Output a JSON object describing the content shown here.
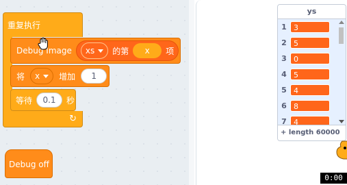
{
  "blocks": {
    "repeat_label": "重复执行",
    "debug_image": {
      "label": "Debug Image",
      "list_name": "xs",
      "of_label": "的第",
      "index_var": "x",
      "item_label": "项"
    },
    "change": {
      "label_prefix": "将",
      "var_name": "x",
      "label_mid": "增加",
      "amount": "1"
    },
    "wait": {
      "label": "等待",
      "seconds": "0.1",
      "unit": "秒"
    },
    "debug_off_label": "Debug off"
  },
  "list_monitor": {
    "title": "ys",
    "items": [
      {
        "index": "1",
        "value": "3"
      },
      {
        "index": "2",
        "value": "5"
      },
      {
        "index": "3",
        "value": "0"
      },
      {
        "index": "4",
        "value": "5"
      },
      {
        "index": "5",
        "value": "4"
      },
      {
        "index": "6",
        "value": "8"
      },
      {
        "index": "7",
        "value": "4"
      }
    ],
    "add_label": "+",
    "length_label": "length 60000",
    "eq_label": "="
  },
  "stage": {
    "timer": "0:00"
  },
  "colors": {
    "control": "#ffab19",
    "extension": "#ff8c1a",
    "list_item": "#ff661a",
    "monitor_bg": "#e6f0ff"
  },
  "icons": [
    "grab-hand-icon",
    "dropdown-caret-icon",
    "loop-arrow-icon",
    "scroll-up-icon",
    "scroll-down-icon"
  ]
}
